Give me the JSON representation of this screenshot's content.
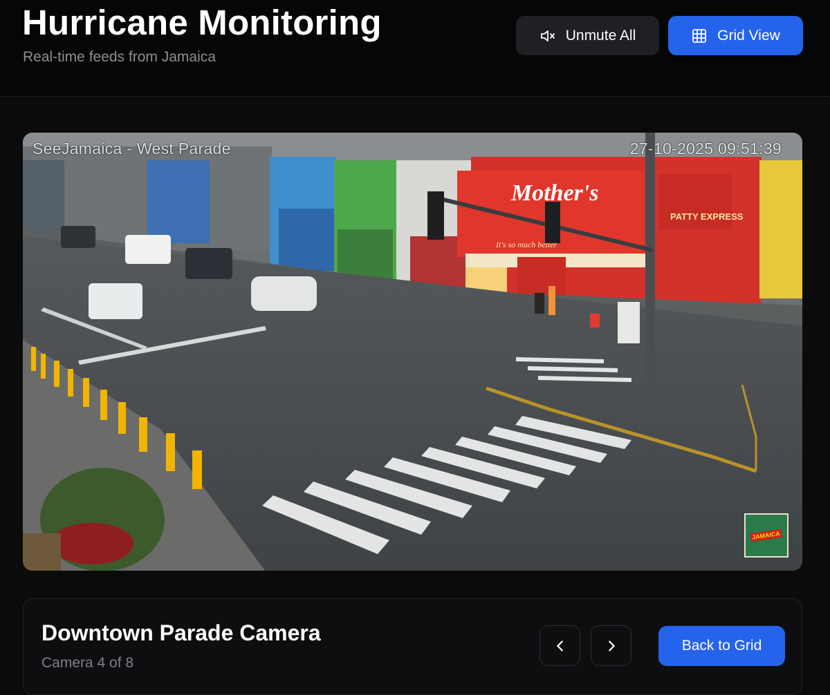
{
  "header": {
    "title": "Hurricane Monitoring",
    "subtitle": "Real-time feeds from Jamaica",
    "unmute_label": "Unmute All",
    "grid_label": "Grid View"
  },
  "feed": {
    "overlay_name": "SeeJamaica - West Parade",
    "overlay_timestamp": "27-10-2025 09:51:39",
    "sign_mothers": "Mother's",
    "sign_slogan": "It's so much better",
    "sign_express": "PATTY EXPRESS",
    "watermark": "JAMAICA"
  },
  "panel": {
    "camera_title": "Downtown Parade Camera",
    "camera_position": "Camera 4 of 8",
    "back_label": "Back to Grid"
  },
  "colors": {
    "accent": "#2563eb",
    "background": "#0b0b0c",
    "muted_text": "#8d8f94"
  },
  "icons": [
    "mute-icon",
    "grid-icon",
    "chevron-left-icon",
    "chevron-right-icon"
  ]
}
